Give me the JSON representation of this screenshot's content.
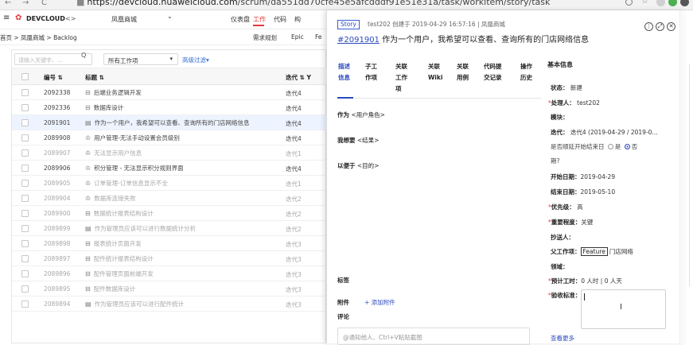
{
  "browser": {
    "back": "←",
    "forward": "→",
    "reload": "C",
    "url_host": "https://devcloud.huaweicloud.com",
    "url_path": "/scrum/da551dd70cfe45e5afcdddf91e51e31a/task/workitem/story/task",
    "icons": [
      "search-icon",
      "star-icon",
      "extension-icon",
      "extension-icon",
      "extension-icon",
      "profile-icon",
      "menu-icon"
    ]
  },
  "app_header": {
    "menu_icon": "≡",
    "brand": "DEVCLOUD",
    "code_icon": "<>",
    "project": "凤凰商城",
    "project_caret": "⌄",
    "nav": [
      "仪表盘",
      "工作",
      "代码",
      "构"
    ]
  },
  "breadcrumb": {
    "path": "首页 > 凤凰商城 > Backlog",
    "tabs": [
      "需求规划",
      "Epic",
      "Fe"
    ]
  },
  "list": {
    "search_placeholder": "请输入关键字、...",
    "search_icon": "Q",
    "type_select": "所有工作项",
    "type_caret": "▾",
    "advanced_filter": "高级过滤▾",
    "columns": {
      "id": "编号 ⇅",
      "title": "标题 ⇅",
      "iteration": "迭代 ⇅ Y"
    },
    "rows": [
      {
        "id": "2092338",
        "icon": "⊟",
        "title": "后端业务逻辑开发",
        "iter": "迭代4",
        "dim": false,
        "selected": false
      },
      {
        "id": "2092336",
        "icon": "⊟",
        "title": "数据库设计",
        "iter": "迭代4",
        "dim": false,
        "selected": false
      },
      {
        "id": "2091901",
        "icon": "▤",
        "title": "作为一个用户，我希望可以查看、查询所有的门店网络信息",
        "iter": "迭代4",
        "dim": false,
        "selected": true
      },
      {
        "id": "2089908",
        "icon": "♔",
        "title": "用户管理-无法手动设置会员级别",
        "iter": "迭代4",
        "dim": false,
        "selected": false
      },
      {
        "id": "2089907",
        "icon": "♔",
        "title": "无法显示用户信息",
        "iter": "迭代1",
        "dim": true,
        "selected": false
      },
      {
        "id": "2089906",
        "icon": "♔",
        "title": "积分管理 - 无法显示积分规则界面",
        "iter": "迭代4",
        "dim": false,
        "selected": false
      },
      {
        "id": "2089905",
        "icon": "♔",
        "title": "订单管理-订单信息显示不全",
        "iter": "迭代1",
        "dim": true,
        "selected": false
      },
      {
        "id": "2089904",
        "icon": "♔",
        "title": "数据库连接失败",
        "iter": "迭代2",
        "dim": true,
        "selected": false
      },
      {
        "id": "2089900",
        "icon": "⊟",
        "title": "数据统计报表结构设计",
        "iter": "迭代2",
        "dim": true,
        "selected": false
      },
      {
        "id": "2089899",
        "icon": "▤",
        "title": "作为管理员应该可以进行数据统计分析",
        "iter": "迭代2",
        "dim": true,
        "selected": false
      },
      {
        "id": "2089898",
        "icon": "⊟",
        "title": "报表统计页面开发",
        "iter": "迭代3",
        "dim": true,
        "selected": false
      },
      {
        "id": "2089897",
        "icon": "⊟",
        "title": "配件统计报表结构设计",
        "iter": "迭代3",
        "dim": true,
        "selected": false
      },
      {
        "id": "2089896",
        "icon": "⊟",
        "title": "配件管理页面前端开发",
        "iter": "迭代3",
        "dim": true,
        "selected": false
      },
      {
        "id": "2089895",
        "icon": "⊟",
        "title": "配件数据库设计",
        "iter": "迭代3",
        "dim": true,
        "selected": false
      },
      {
        "id": "2089894",
        "icon": "▤",
        "title": "作为管理员应该可以进行配件统计",
        "iter": "迭代3",
        "dim": true,
        "selected": false
      }
    ]
  },
  "detail": {
    "type_tag": "Story",
    "meta": "test202  创建于 2019-04-29 16:57:16  |  凤凰商城",
    "number": "#2091901",
    "title": "作为一个用户，我希望可以查看、查询所有的门店网络信息",
    "header_buttons": [
      "⋮",
      "⤢",
      "✕"
    ],
    "tabs": [
      {
        "label": "描述\n信息",
        "active": true
      },
      {
        "label": "子工\n作项",
        "active": false
      },
      {
        "label": "关联\n工作\n项",
        "active": false
      },
      {
        "label": "关联\nWiki",
        "active": false
      },
      {
        "label": "关联\n用例",
        "active": false
      },
      {
        "label": "代码提\n交记录",
        "active": false
      },
      {
        "label": "操作\n历史",
        "active": false
      }
    ],
    "as_label": "作为",
    "as_value": "<用户角色>",
    "want_label": "我想要",
    "want_value": "<结果>",
    "so_label": "以便于",
    "so_value": "<目的>",
    "tags_label": "标签",
    "attach_label": "附件",
    "add_attach": "+ 添加附件",
    "comment_label": "评论",
    "comment_placeholder": "@通知他人、Ctrl+V粘贴截图",
    "basic_info_title": "基本信息",
    "props": {
      "status_k": "状态：",
      "status_v": "新建",
      "handler_k": "处理人：",
      "handler_v": "test202",
      "module_k": "模块：",
      "iteration_k": "迭代：",
      "iteration_v": "迭代4 (2019-04-29 / 2019-0...",
      "delay_q1": "是否顺延开始结束日",
      "delay_yes": "是",
      "delay_no": "否",
      "delay_q2": "期?",
      "start_k": "开始日期：",
      "start_v": "2019-04-29",
      "end_k": "结束日期：",
      "end_v": "2019-05-10",
      "priority_k": "优先级：",
      "priority_v": "高",
      "importance_k": "重要程度：",
      "importance_v": "关键",
      "cc_k": "抄送人：",
      "parent_k": "父工作项：",
      "parent_tag": "Feature",
      "parent_v": "门店网络",
      "domain_k": "领域：",
      "estimate_k": "预计工时：",
      "estimate_v": "0 人时   |   0 人天",
      "acceptance_k": "验收标准："
    },
    "see_more": "查看更多"
  }
}
